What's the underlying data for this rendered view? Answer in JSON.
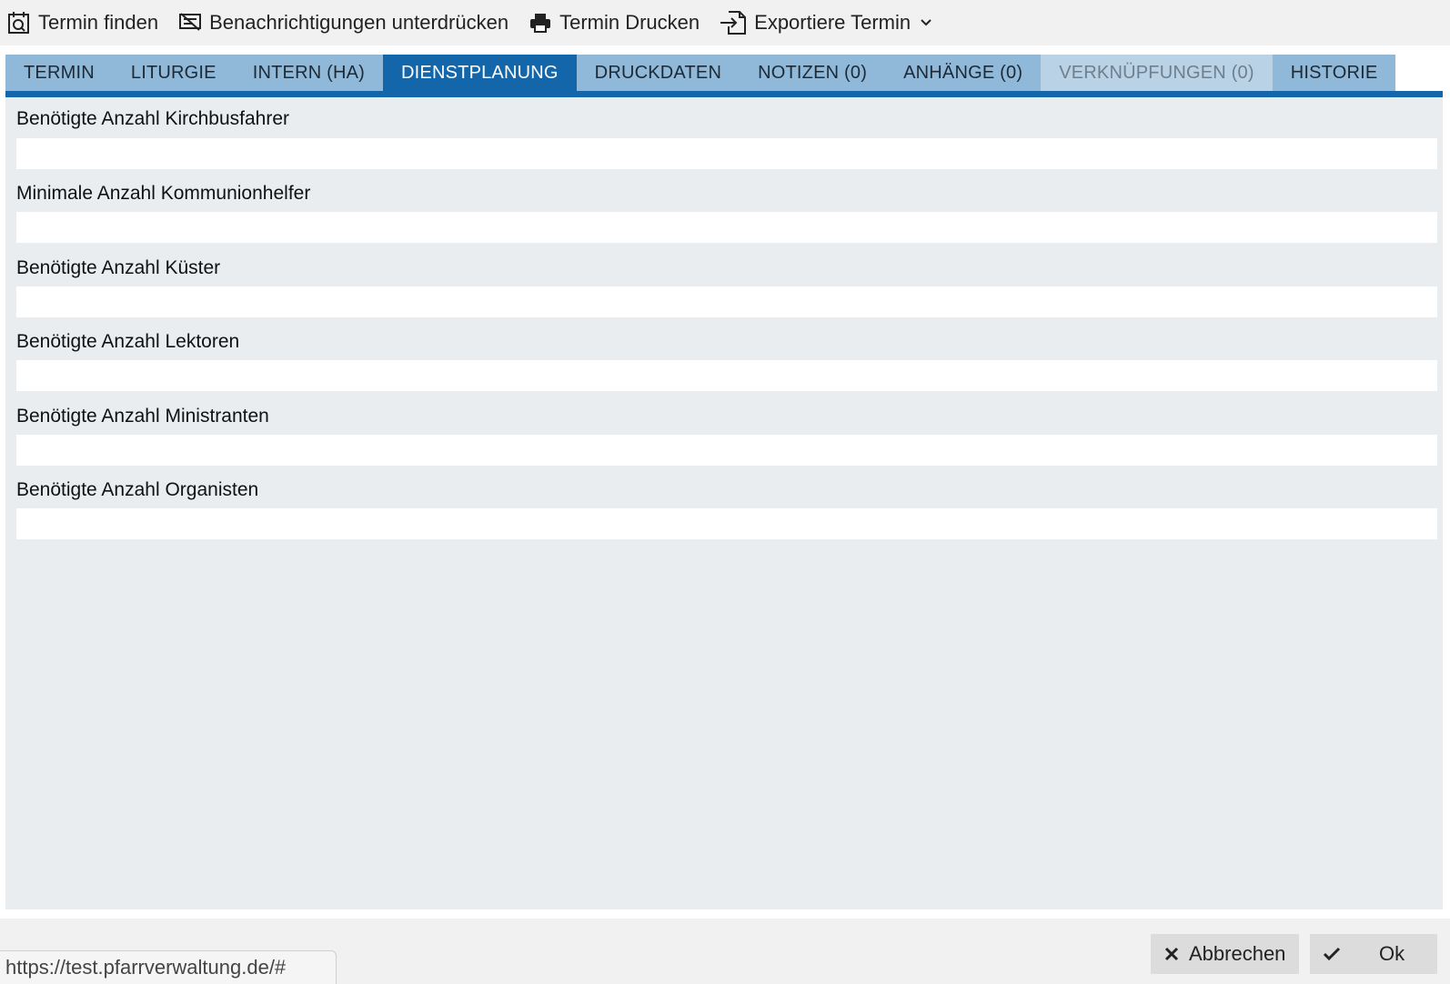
{
  "toolbar": {
    "find_label": "Termin finden",
    "suppress_label": "Benachrichtigungen unterdrücken",
    "print_label": "Termin Drucken",
    "export_label": "Exportiere Termin"
  },
  "tabs": [
    {
      "label": "TERMIN",
      "state": "normal"
    },
    {
      "label": "LITURGIE",
      "state": "normal"
    },
    {
      "label": "INTERN (HA)",
      "state": "normal"
    },
    {
      "label": "DIENSTPLANUNG",
      "state": "active"
    },
    {
      "label": "DRUCKDATEN",
      "state": "normal"
    },
    {
      "label": "NOTIZEN (0)",
      "state": "normal"
    },
    {
      "label": "ANHÄNGE (0)",
      "state": "normal"
    },
    {
      "label": "VERKNÜPFUNGEN (0)",
      "state": "disabled"
    },
    {
      "label": "HISTORIE",
      "state": "normal"
    }
  ],
  "fields": [
    {
      "label": "Benötigte Anzahl Kirchbusfahrer",
      "value": ""
    },
    {
      "label": "Minimale Anzahl Kommunionhelfer",
      "value": ""
    },
    {
      "label": "Benötigte Anzahl Küster",
      "value": ""
    },
    {
      "label": "Benötigte Anzahl Lektoren",
      "value": ""
    },
    {
      "label": "Benötigte Anzahl Ministranten",
      "value": ""
    },
    {
      "label": "Benötigte Anzahl Organisten",
      "value": ""
    }
  ],
  "footer": {
    "cancel_label": "Abbrechen",
    "ok_label": "Ok"
  },
  "status_url": "https://test.pfarrverwaltung.de/#",
  "colors": {
    "tab_active": "#1466aa",
    "tab_normal": "#8fb8d9",
    "tab_disabled": "#b9d2e6",
    "panel": "#e9edf0"
  }
}
